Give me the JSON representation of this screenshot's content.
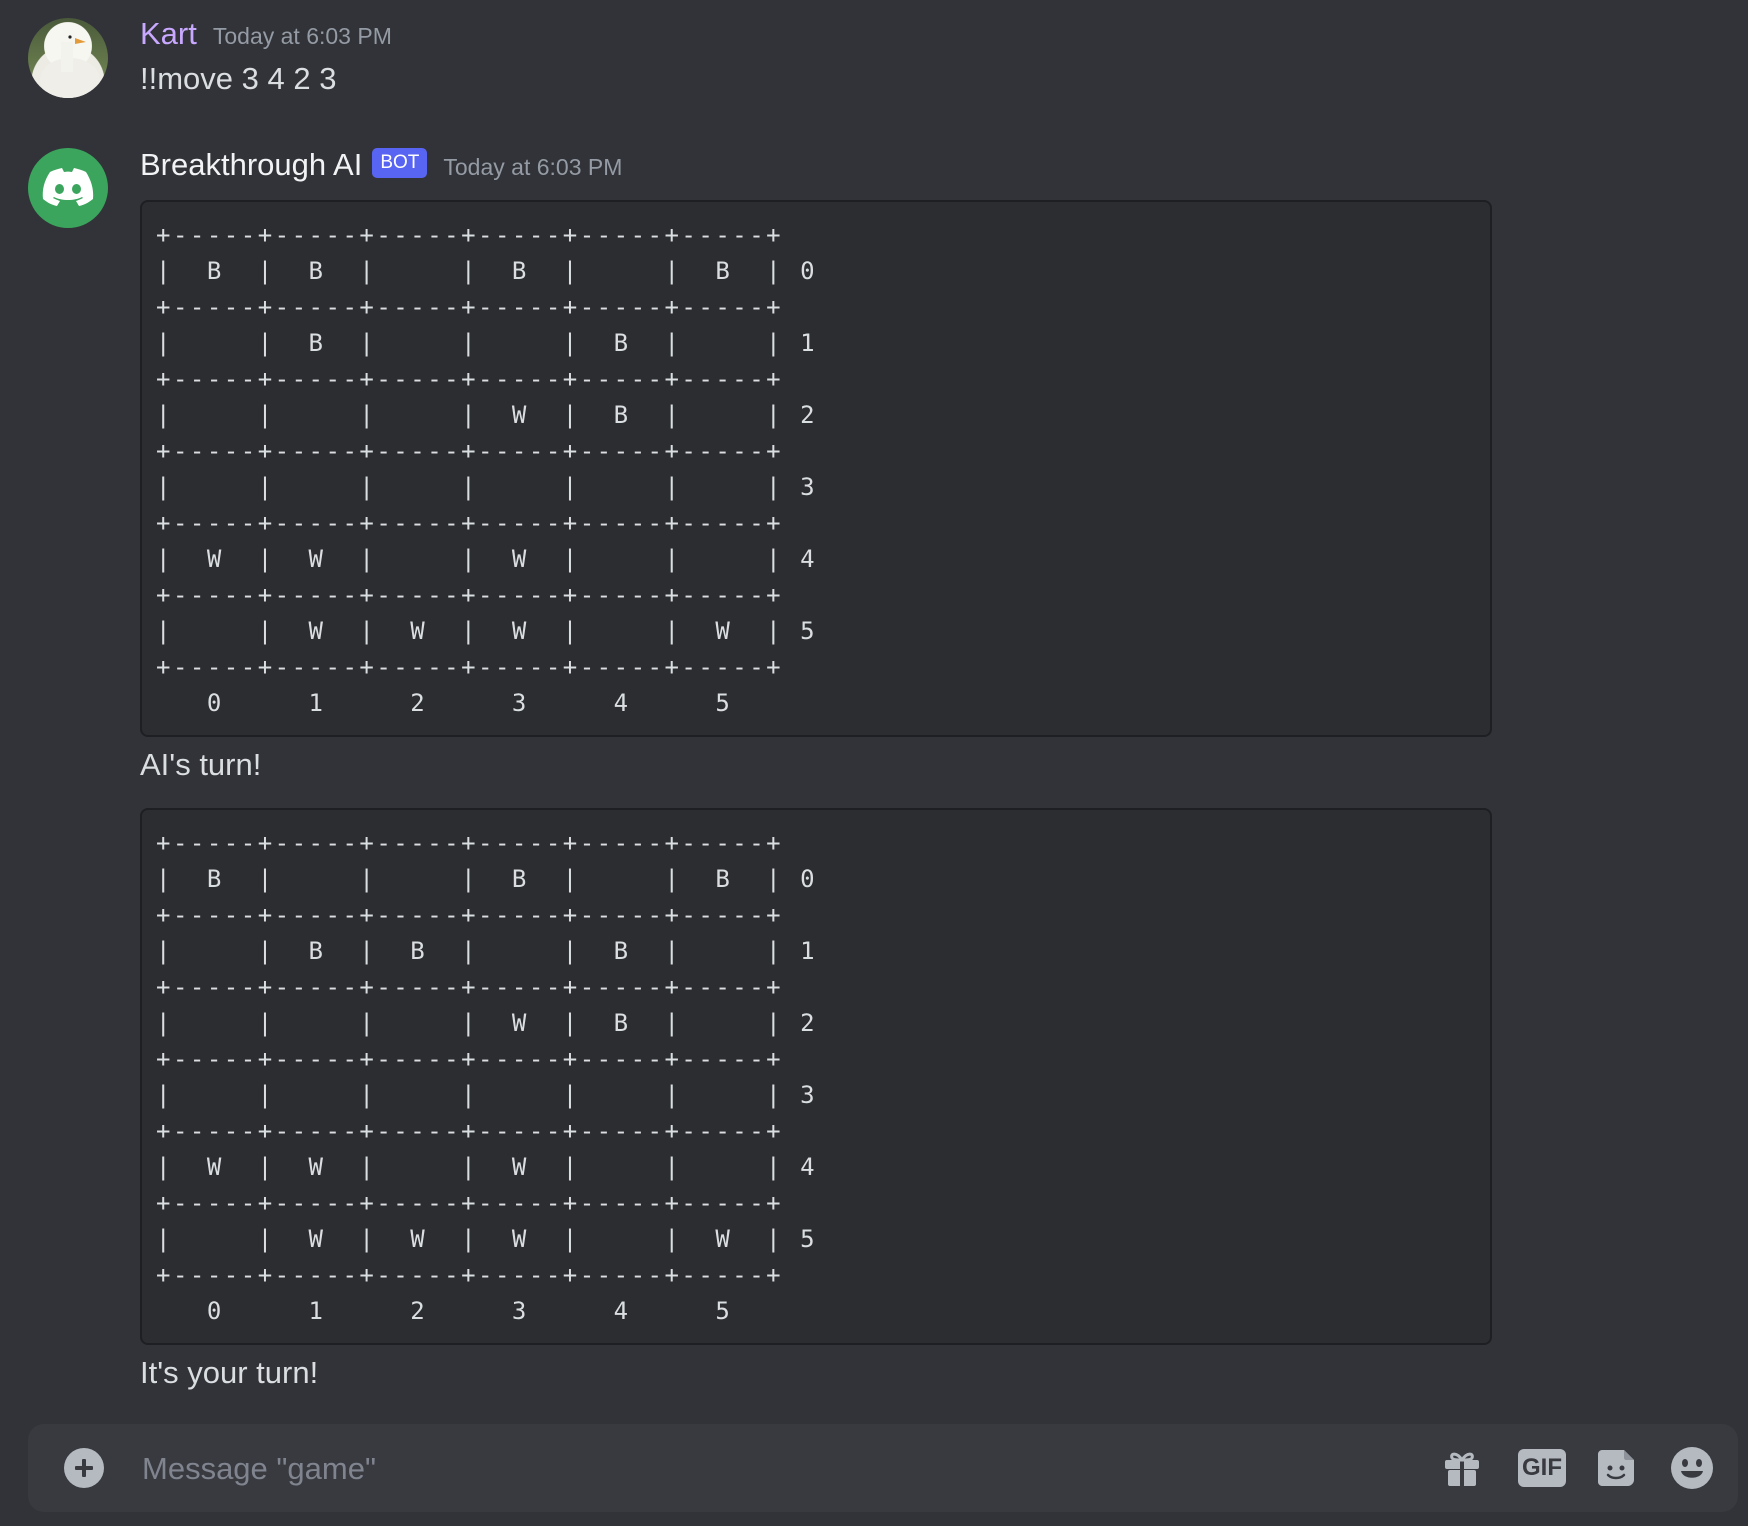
{
  "channel": {
    "name": "game"
  },
  "messages": [
    {
      "author": "Kart",
      "timestamp": "Today at 6:03 PM",
      "avatar": "goose-avatar",
      "text": "!!move 3 4 2 3"
    },
    {
      "author": "Breakthrough AI",
      "tag": "BOT",
      "timestamp": "Today at 6:03 PM",
      "avatar": "discord-logo-avatar",
      "avatar_color": "#3ba55d",
      "board1": "+-----+-----+-----+-----+-----+-----+\n|  B  |  B  |     |  B  |     |  B  | 0\n+-----+-----+-----+-----+-----+-----+\n|     |  B  |     |     |  B  |     | 1\n+-----+-----+-----+-----+-----+-----+\n|     |     |     |  W  |  B  |     | 2\n+-----+-----+-----+-----+-----+-----+\n|     |     |     |     |     |     | 3\n+-----+-----+-----+-----+-----+-----+\n|  W  |  W  |     |  W  |     |     | 4\n+-----+-----+-----+-----+-----+-----+\n|     |  W  |  W  |  W  |     |  W  | 5\n+-----+-----+-----+-----+-----+-----+\n   0     1     2     3     4     5",
      "text1": "AI's turn!",
      "board2": "+-----+-----+-----+-----+-----+-----+\n|  B  |     |     |  B  |     |  B  | 0\n+-----+-----+-----+-----+-----+-----+\n|     |  B  |  B  |     |  B  |     | 1\n+-----+-----+-----+-----+-----+-----+\n|     |     |     |  W  |  B  |     | 2\n+-----+-----+-----+-----+-----+-----+\n|     |     |     |     |     |     | 3\n+-----+-----+-----+-----+-----+-----+\n|  W  |  W  |     |  W  |     |     | 4\n+-----+-----+-----+-----+-----+-----+\n|     |  W  |  W  |  W  |     |  W  | 5\n+-----+-----+-----+-----+-----+-----+\n   0     1     2     3     4     5",
      "text2": "It's your turn!"
    }
  ],
  "composer": {
    "placeholder": "Message \"game\"",
    "icons": [
      "add-attachment-icon",
      "gift-icon",
      "gif-icon",
      "sticker-icon",
      "emoji-icon"
    ],
    "gif_label": "GIF"
  },
  "colors": {
    "background": "#313338",
    "codeblock": "#2b2d31",
    "user_name": "#c9a8ff",
    "bot_tag": "#5865f2"
  }
}
